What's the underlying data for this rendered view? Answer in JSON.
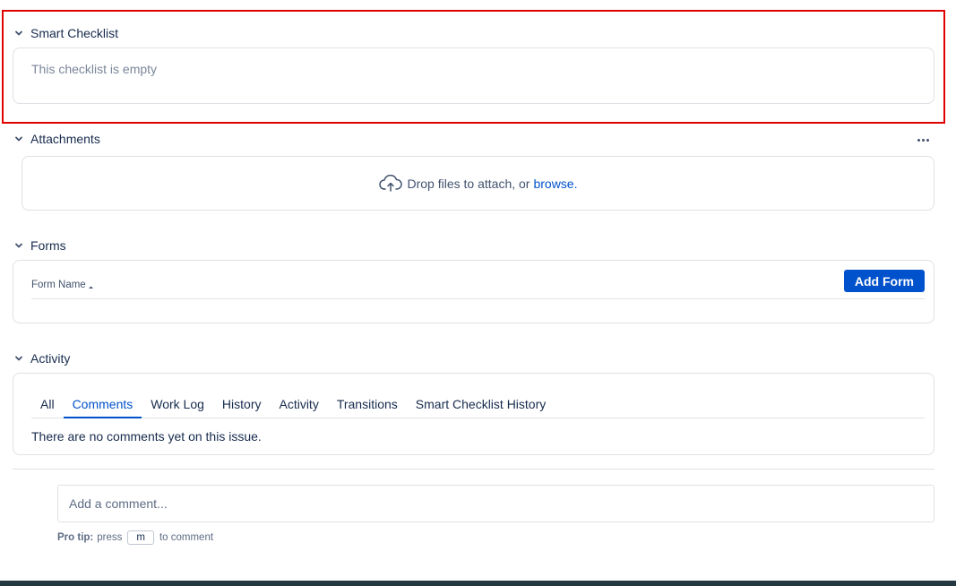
{
  "smart_checklist": {
    "title": "Smart Checklist",
    "empty_text": "This checklist is empty"
  },
  "attachments": {
    "title": "Attachments",
    "drop_text": "Drop files to attach, or",
    "browse_label": "browse.",
    "more_icon": "more-horizontal-icon",
    "upload_icon": "cloud-upload-icon"
  },
  "forms": {
    "title": "Forms",
    "column_label": "Form Name",
    "sort_icon": "sort-ascending-icon",
    "add_button": "Add Form"
  },
  "activity": {
    "title": "Activity",
    "tabs": [
      {
        "label": "All",
        "active": false
      },
      {
        "label": "Comments",
        "active": true
      },
      {
        "label": "Work Log",
        "active": false
      },
      {
        "label": "History",
        "active": false
      },
      {
        "label": "Activity",
        "active": false
      },
      {
        "label": "Transitions",
        "active": false
      },
      {
        "label": "Smart Checklist History",
        "active": false
      }
    ],
    "empty_text": "There are no comments yet on this issue."
  },
  "comment": {
    "placeholder": "Add a comment...",
    "pro_tip_label": "Pro tip:",
    "pro_tip_press": "press",
    "pro_tip_key": "m",
    "pro_tip_suffix": "to comment"
  },
  "colors": {
    "accent": "#0052cc",
    "highlight": "#e00000",
    "footer": "#233840"
  }
}
